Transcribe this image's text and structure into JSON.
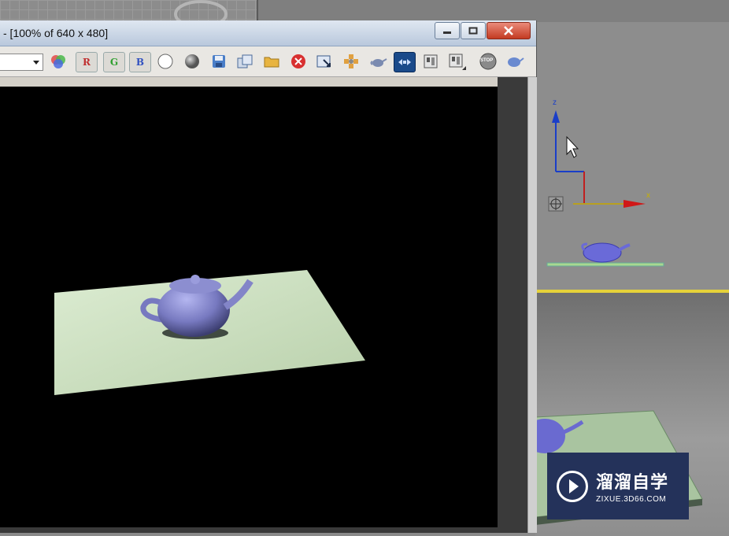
{
  "render_window": {
    "title": "- [100% of 640 x 480]",
    "channel_select_value": ""
  },
  "toolbar": {
    "buttons": [
      {
        "name": "color-channels-icon"
      },
      {
        "name": "red-channel-toggle",
        "label": "R"
      },
      {
        "name": "green-channel-toggle",
        "label": "G"
      },
      {
        "name": "blue-channel-toggle",
        "label": "B"
      },
      {
        "name": "white-alpha-icon"
      },
      {
        "name": "mono-icon"
      },
      {
        "name": "save-image-icon"
      },
      {
        "name": "clone-window-icon"
      },
      {
        "name": "open-folder-icon"
      },
      {
        "name": "clear-icon"
      },
      {
        "name": "region-icon"
      },
      {
        "name": "blowup-icon"
      },
      {
        "name": "teapot-render-icon"
      },
      {
        "name": "render-setup-icon"
      },
      {
        "name": "print-icon"
      },
      {
        "name": "channel-display-icon"
      },
      {
        "name": "stop-icon",
        "label": "STOP"
      },
      {
        "name": "render-icon"
      }
    ]
  },
  "viewport": {
    "axis_z": "z",
    "axis_x": "x"
  },
  "watermark": {
    "title": "溜溜自学",
    "subtitle": "ZIXUE.3D66.COM"
  },
  "colors": {
    "accent_yellow": "#e6d23a",
    "render_bg": "#000000",
    "plane": "#c8dcb8",
    "teapot": "#7a7ab8",
    "watermark_bg": "#24325a"
  }
}
